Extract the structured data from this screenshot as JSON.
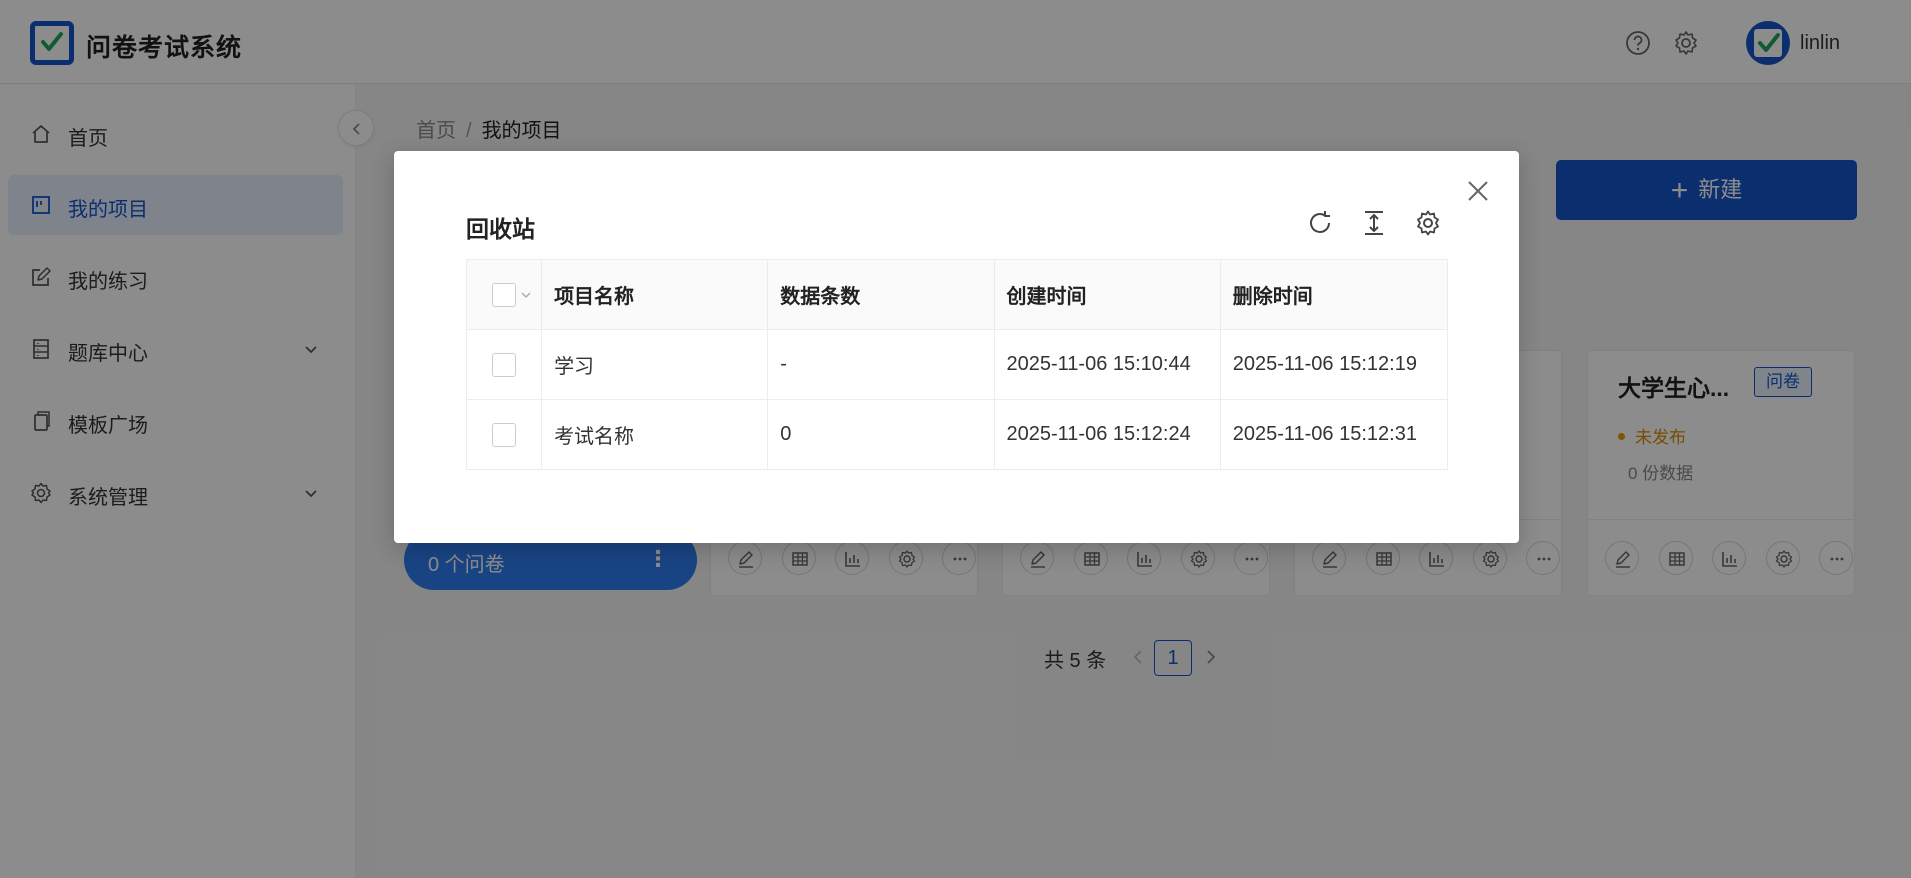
{
  "app": {
    "title": "问卷考试系统",
    "username": "linlin",
    "icons": [
      "help-icon",
      "gear-icon"
    ]
  },
  "sidebar": {
    "items": [
      {
        "label": "首页",
        "icon": "home-icon"
      },
      {
        "label": "我的项目",
        "icon": "project-board-icon",
        "active": true
      },
      {
        "label": "我的练习",
        "icon": "edit-icon"
      },
      {
        "label": "题库中心",
        "icon": "database-icon",
        "expandable": true
      },
      {
        "label": "模板广场",
        "icon": "copy-icon"
      },
      {
        "label": "系统管理",
        "icon": "gear-icon",
        "expandable": true
      }
    ]
  },
  "breadcrumb": {
    "home": "首页",
    "separator": "/",
    "current": "我的项目"
  },
  "toolbar": {
    "new_label": "新建",
    "new_icon": "+"
  },
  "folder": {
    "count_label": "0 个问卷",
    "more": "⋮"
  },
  "card": {
    "title": "大学生心...",
    "tag": "问卷",
    "status": "未发布",
    "data_count": "0 份数据"
  },
  "pagination": {
    "total": "共 5 条",
    "current_page": "1"
  },
  "modal": {
    "title": "回收站",
    "tools": [
      "refresh-icon",
      "column-height-icon",
      "setting-icon"
    ],
    "columns": [
      "项目名称",
      "数据条数",
      "创建时间",
      "删除时间"
    ],
    "rows": [
      {
        "name": "学习",
        "count": "-",
        "created": "2025-11-06 15:10:44",
        "deleted": "2025-11-06 15:12:19"
      },
      {
        "name": "考试名称",
        "count": "0",
        "created": "2025-11-06 15:12:24",
        "deleted": "2025-11-06 15:12:31"
      }
    ]
  },
  "colors": {
    "primary": "#1456c8",
    "folder": "#2f7cf0",
    "warning": "#d98c00",
    "mask": "rgba(0,0,0,0.45)"
  }
}
